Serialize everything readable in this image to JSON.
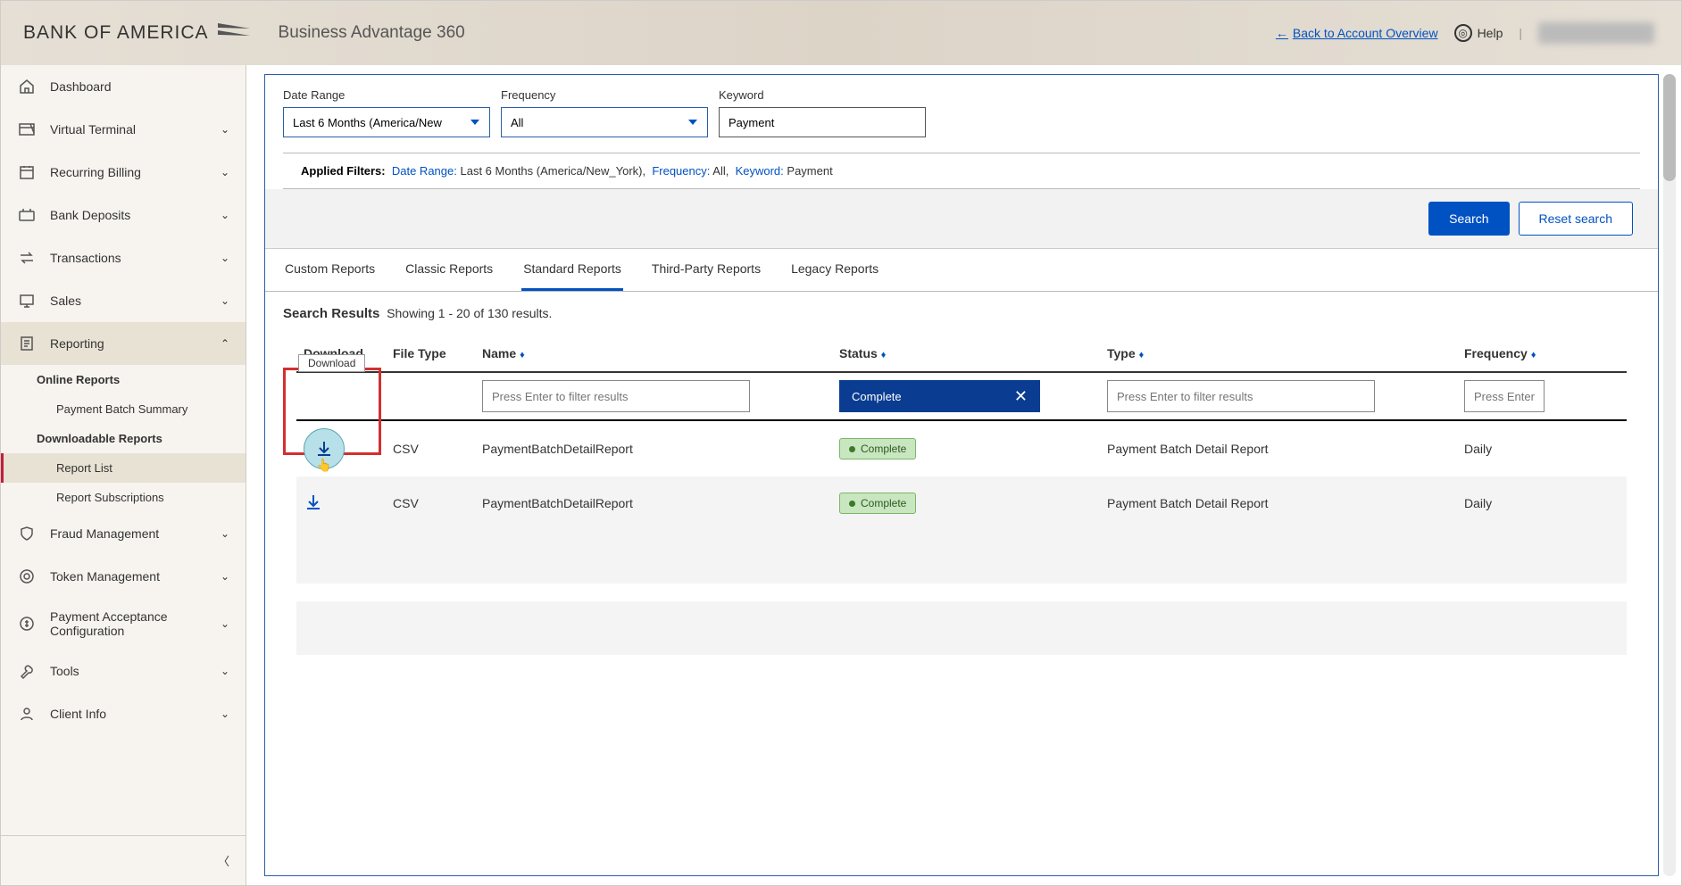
{
  "header": {
    "logo_text": "BANK OF AMERICA",
    "product_name": "Business Advantage 360",
    "back_link": "Back to Account Overview",
    "help": "Help"
  },
  "sidebar": {
    "items": [
      {
        "label": "Dashboard",
        "icon": "home"
      },
      {
        "label": "Virtual Terminal",
        "icon": "terminal",
        "expandable": true
      },
      {
        "label": "Recurring Billing",
        "icon": "calendar",
        "expandable": true
      },
      {
        "label": "Bank Deposits",
        "icon": "deposit",
        "expandable": true
      },
      {
        "label": "Transactions",
        "icon": "exchange",
        "expandable": true
      },
      {
        "label": "Sales",
        "icon": "screen",
        "expandable": true
      },
      {
        "label": "Reporting",
        "icon": "report",
        "expanded": true
      },
      {
        "label": "Fraud Management",
        "icon": "shield",
        "expandable": true
      },
      {
        "label": "Token Management",
        "icon": "token",
        "expandable": true
      },
      {
        "label": "Payment Acceptance Configuration",
        "icon": "payconfig",
        "expandable": true
      },
      {
        "label": "Tools",
        "icon": "wrench",
        "expandable": true
      },
      {
        "label": "Client Info",
        "icon": "person",
        "expandable": true
      }
    ],
    "reporting_sub": {
      "online_reports": "Online Reports",
      "payment_batch": "Payment Batch Summary",
      "downloadable": "Downloadable Reports",
      "report_list": "Report List",
      "report_subs": "Report Subscriptions"
    }
  },
  "filters": {
    "date_range_label": "Date Range",
    "date_range_value": "Last 6 Months (America/New",
    "frequency_label": "Frequency",
    "frequency_value": "All",
    "keyword_label": "Keyword",
    "keyword_value": "Payment"
  },
  "applied": {
    "label": "Applied Filters:",
    "dr_label": "Date Range:",
    "dr_val": "Last 6 Months (America/New_York),",
    "freq_label": "Frequency:",
    "freq_val": "All,",
    "kw_label": "Keyword:",
    "kw_val": "Payment"
  },
  "buttons": {
    "search": "Search",
    "reset": "Reset search"
  },
  "tabs": [
    "Custom Reports",
    "Classic Reports",
    "Standard Reports",
    "Third-Party Reports",
    "Legacy Reports"
  ],
  "results": {
    "title": "Search Results",
    "summary": "Showing 1 - 20 of 130 results."
  },
  "columns": {
    "download": "Download",
    "filetype": "File Type",
    "name": "Name",
    "status": "Status",
    "type": "Type",
    "frequency": "Frequency"
  },
  "col_filters": {
    "placeholder": "Press Enter to filter results",
    "placeholder_short": "Press Enter to",
    "status_value": "Complete"
  },
  "rows": [
    {
      "filetype": "CSV",
      "name": "PaymentBatchDetailReport",
      "status": "Complete",
      "type": "Payment Batch Detail Report",
      "frequency": "Daily"
    },
    {
      "filetype": "CSV",
      "name": "PaymentBatchDetailReport",
      "status": "Complete",
      "type": "Payment Batch Detail Report",
      "frequency": "Daily"
    }
  ],
  "tooltip": "Download"
}
